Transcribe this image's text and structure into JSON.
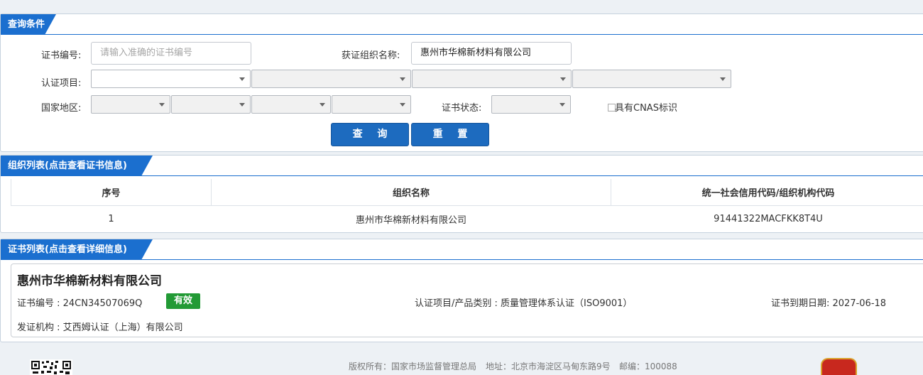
{
  "query_panel": {
    "tab_label": "查询条件",
    "cert_no_label": "证书编号:",
    "cert_no_placeholder": "请输入准确的证书编号",
    "org_name_label": "获证组织名称:",
    "org_name_value": "惠州市华棉新材料有限公司",
    "cert_item_label": "认证项目:",
    "region_label": "国家地区:",
    "cert_status_label": "证书状态:",
    "cnas_label": "具有CNAS标识",
    "search_button": "查 询",
    "reset_button": "重 置"
  },
  "org_panel": {
    "tab_label": "组织列表(点击查看证书信息)",
    "columns": [
      "序号",
      "组织名称",
      "统一社会信用代码/组织机构代码"
    ],
    "rows": [
      {
        "index": "1",
        "name": "惠州市华棉新材料有限公司",
        "code": "91441322MACFKK8T4U"
      }
    ]
  },
  "cert_panel": {
    "tab_label": "证书列表(点击查看详细信息)",
    "company": "惠州市华棉新材料有限公司",
    "cert_no": "证书编号 : 24CN34507069Q",
    "status_badge": "有效",
    "status_color": "#229a35",
    "category": "认证项目/产品类别 : 质量管理体系认证（ISO9001）",
    "expiry": "证书到期日期: 2027-06-18",
    "issuer": "发证机构 : 艾西姆认证（上海）有限公司"
  },
  "footer": {
    "copyright": "版权所有：国家市场监督管理总局",
    "address": "地址：北京市海淀区马甸东路9号",
    "postcode": "邮编：100088"
  },
  "colors": {
    "accent": "#1b6fcf",
    "button": "#1d6bbf"
  }
}
